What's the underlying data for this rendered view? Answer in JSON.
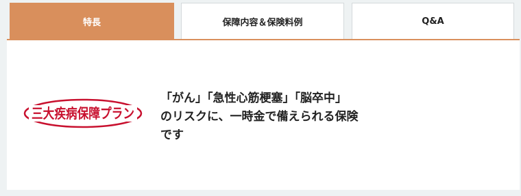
{
  "tabs": [
    {
      "label": "特長",
      "active": true
    },
    {
      "label": "保障内容＆保険料例",
      "active": false
    },
    {
      "label": "Q&A",
      "active": false
    }
  ],
  "panel": {
    "logo": {
      "text": "三大疾病保障プラン",
      "color": "#c8102e"
    },
    "description_lines": [
      "「がん」「急性心筋梗塞」「脳卒中」",
      "のリスクに、一時金で備えられる保険",
      "です"
    ]
  },
  "colors": {
    "accent": "#d98f5c",
    "background": "#eef2f3",
    "logo_red": "#c8102e"
  }
}
